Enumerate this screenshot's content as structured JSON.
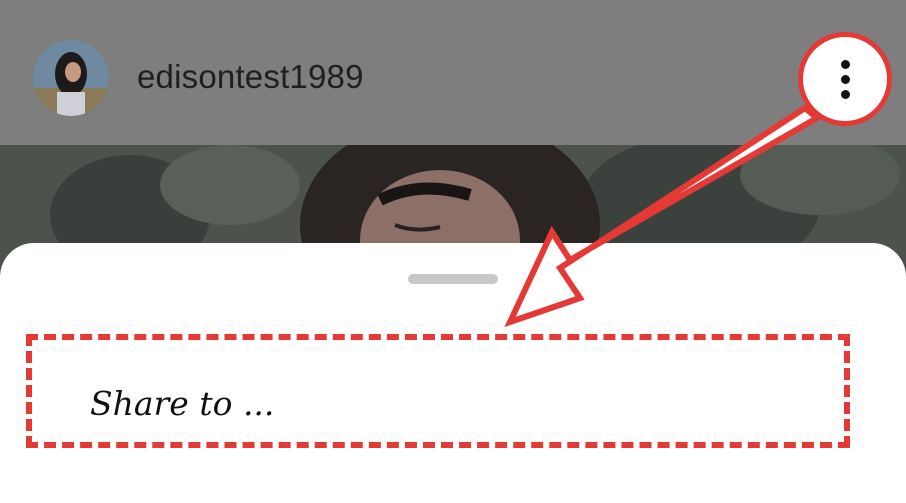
{
  "post_header": {
    "username": "edisontest1989",
    "avatar_icon": "profile-avatar",
    "more_icon": "vertical-ellipsis-icon"
  },
  "bottom_sheet": {
    "share_label": "Share to ..."
  },
  "annotation": {
    "color": "#e53935"
  }
}
